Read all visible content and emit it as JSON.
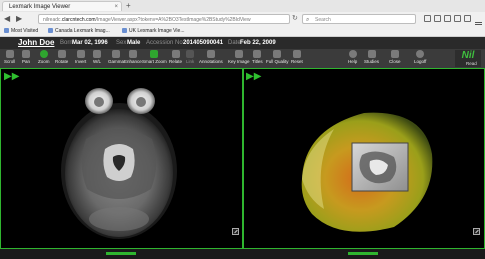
{
  "browser": {
    "tab_title": "Lexmark Image Viewer",
    "tab_close": "×",
    "new_tab": "+",
    "url_host": "clarcntech.com",
    "url_rest": "/ImageViewer.aspx?tokenv=A%2BO3TestImage%2BStudy%2BIdView",
    "url_prefix": "nilreadc.",
    "search_placeholder": "Search",
    "back": "◀",
    "forward": "▶",
    "reload": "↻",
    "search_icon": "⌕"
  },
  "bookmarks": [
    {
      "label": "Most Visited"
    },
    {
      "label": "Canada Lexmark Imag..."
    },
    {
      "label": "UK Lexmark Image Vie..."
    }
  ],
  "patient": {
    "name": "John Doe",
    "born_label": "Born",
    "born_value": "Mar 02, 1996",
    "sex_label": "Sex",
    "sex_value": "Male",
    "accession_label": "Accession No.",
    "accession_value": "201405090041",
    "date_label": "Date",
    "date_value": "Feb 22, 2009"
  },
  "toolbar": {
    "tools": [
      {
        "label": "Scroll",
        "icon": "scroll-icon"
      },
      {
        "label": "Pan",
        "icon": "pan-icon"
      },
      {
        "label": "Zoom",
        "icon": "zoom-icon"
      },
      {
        "label": "Rotate",
        "icon": "rotate-icon"
      },
      {
        "label": "Invert",
        "icon": "invert-icon"
      },
      {
        "label": "W/L",
        "icon": "window-level-icon"
      },
      {
        "label": "Gamma",
        "icon": "gamma-icon"
      },
      {
        "label": "Enhance",
        "icon": "enhance-icon"
      },
      {
        "label": "Smart Zoom",
        "icon": "smart-zoom-icon"
      },
      {
        "label": "Relate",
        "icon": "relate-icon"
      },
      {
        "label": "Link",
        "icon": "link-icon"
      },
      {
        "label": "Annotations",
        "icon": "annotations-icon"
      },
      {
        "label": "Key Image",
        "icon": "key-image-icon"
      },
      {
        "label": "Titles",
        "icon": "titles-icon"
      },
      {
        "label": "Full Quality",
        "icon": "full-quality-icon"
      },
      {
        "label": "Reset",
        "icon": "reset-icon"
      }
    ],
    "right_tools": [
      {
        "label": "Help",
        "icon": "help-icon"
      },
      {
        "label": "Studies",
        "icon": "studies-icon"
      },
      {
        "label": "Close",
        "icon": "close-icon"
      },
      {
        "label": "Logoff",
        "icon": "logoff-icon"
      }
    ],
    "logo_text": "Nil",
    "logo_sub": "Read"
  },
  "viewer": {
    "play_left": "▶▶",
    "play_right": "▶▶"
  },
  "colors": {
    "accent_green": "#2fb52f",
    "toolbar_bg": "#3b3b3b",
    "header_bg": "#2a2a2a"
  }
}
